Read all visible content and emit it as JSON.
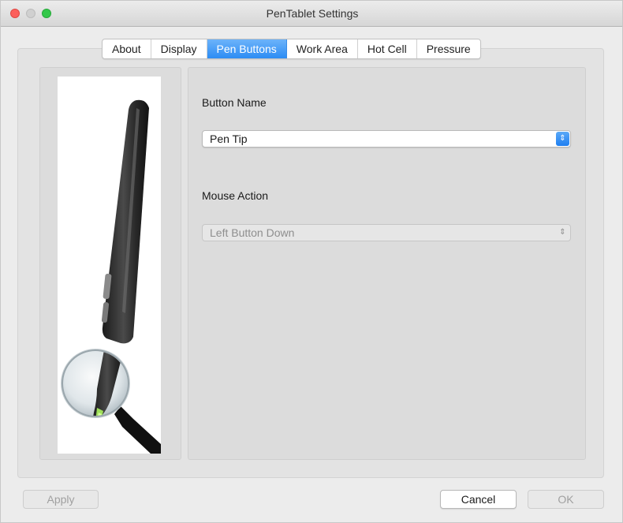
{
  "window": {
    "title": "PenTablet Settings"
  },
  "tabs": [
    {
      "label": "About",
      "active": false
    },
    {
      "label": "Display",
      "active": false
    },
    {
      "label": "Pen Buttons",
      "active": true
    },
    {
      "label": "Work Area",
      "active": false
    },
    {
      "label": "Hot Cell",
      "active": false
    },
    {
      "label": "Pressure",
      "active": false
    }
  ],
  "pen_buttons": {
    "button_name_label": "Button Name",
    "button_name_value": "Pen Tip",
    "mouse_action_label": "Mouse Action",
    "mouse_action_value": "Left Button Down"
  },
  "footer": {
    "apply_label": "Apply",
    "cancel_label": "Cancel",
    "ok_label": "OK"
  },
  "colors": {
    "accent": "#2c8cf4",
    "close": "#fc605c",
    "maximize": "#34c84a",
    "minimize_disabled": "#d0d0d0"
  },
  "icons": {
    "popup_arrows": "updown-chevron-icon",
    "pen_illustration": "pen-with-magnifier-icon"
  }
}
